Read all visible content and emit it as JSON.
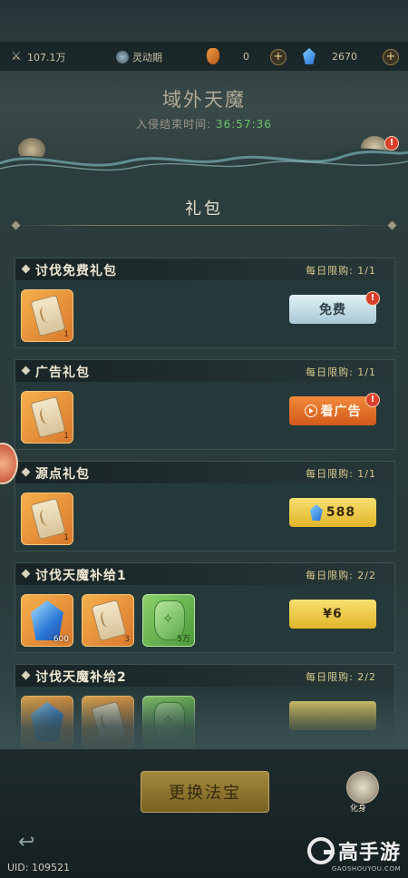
{
  "topbar": {
    "power": "107.1万",
    "phase": "灵动期",
    "amber_count": "0",
    "crystal_count": "2670"
  },
  "boss": {
    "title": "域外天魔",
    "timer_label": "入侵结束时间:",
    "timer_value": "36:57:36"
  },
  "panel": {
    "title": "礼包"
  },
  "packs": [
    {
      "name": "讨伐免费礼包",
      "limit": "每日限购: 1/1",
      "items": [
        {
          "type": "scroll",
          "qty": "1"
        }
      ],
      "button": "免费"
    },
    {
      "name": "广告礼包",
      "limit": "每日限购: 1/1",
      "items": [
        {
          "type": "scroll",
          "qty": "1"
        }
      ],
      "button": "看广告"
    },
    {
      "name": "源点礼包",
      "limit": "每日限购: 1/1",
      "items": [
        {
          "type": "scroll",
          "qty": "1"
        }
      ],
      "button": "588"
    },
    {
      "name": "讨伐天魔补给1",
      "limit": "每日限购: 2/2",
      "items": [
        {
          "type": "crystal",
          "qty": "600"
        },
        {
          "type": "scroll",
          "qty": "3"
        },
        {
          "type": "rune",
          "qty": "5万"
        }
      ],
      "button": "¥6"
    },
    {
      "name": "讨伐天魔补给2",
      "limit": "每日限购: 2/2"
    }
  ],
  "bottom": {
    "change_button": "更换法宝",
    "avatar_label": "化身",
    "uid": "UID: 109521",
    "logo_text": "高手游",
    "logo_sub": "GAOSHOUYOU.COM"
  },
  "colors": {
    "accent_gold": "#e0b52a",
    "ad_orange": "#d25a1c",
    "timer_green": "#6ec36a"
  }
}
